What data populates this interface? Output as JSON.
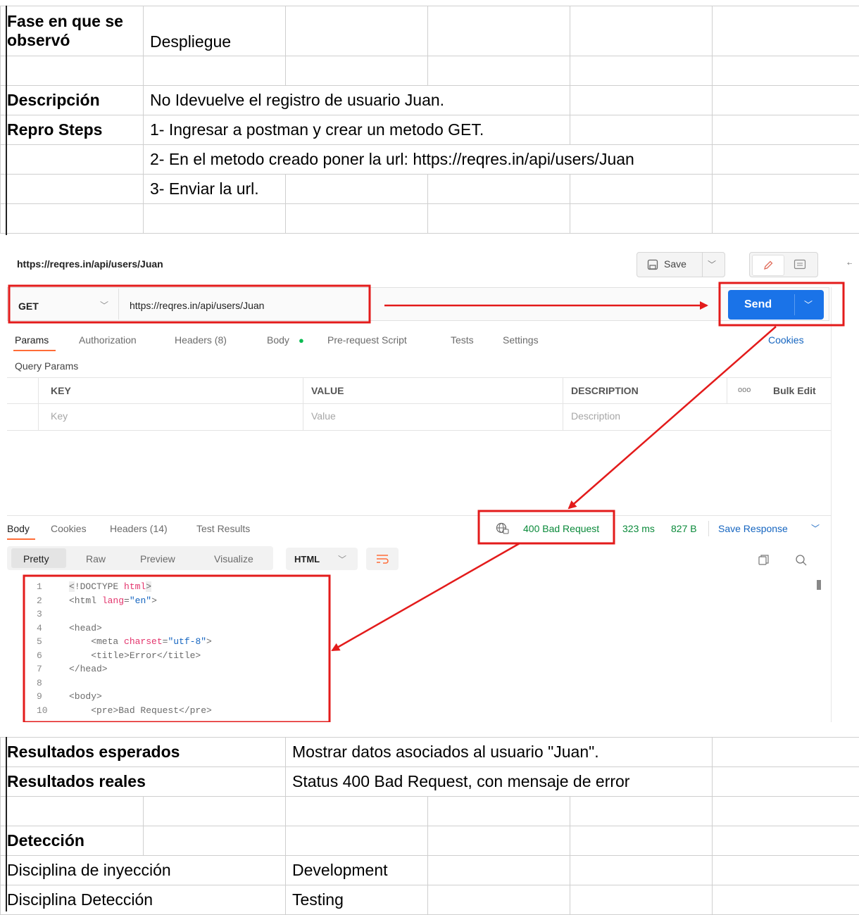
{
  "sheet_top": {
    "rows": [
      {
        "label": "Fase en que se observó",
        "value": "Despliegue"
      },
      {
        "label": "",
        "value": ""
      },
      {
        "label": "Descripción",
        "value": "No Idevuelve el registro de usuario Juan."
      },
      {
        "label": "Repro Steps",
        "value": "1- Ingresar a postman y crear un metodo GET."
      },
      {
        "label": "",
        "value": "2- En el metodo creado poner la url: https://reqres.in/api/users/Juan"
      },
      {
        "label": "",
        "value": "3- Enviar la url."
      },
      {
        "label": "",
        "value": ""
      }
    ],
    "fase_line1": "Fase en que se",
    "fase_line2": "observó"
  },
  "postman": {
    "request_title": "https://reqres.in/api/users/Juan",
    "save_label": "Save",
    "method": "GET",
    "url": "https://reqres.in/api/users/Juan",
    "send_label": "Send",
    "tabs": [
      "Params",
      "Authorization",
      "Headers (8)",
      "Body",
      "Pre-request Script",
      "Tests",
      "Settings"
    ],
    "cookies_link": "Cookies",
    "query_params_label": "Query Params",
    "table_headers": {
      "key": "KEY",
      "value": "VALUE",
      "description": "DESCRIPTION",
      "bulk_edit": "Bulk Edit",
      "more": "ooo"
    },
    "placeholders": {
      "key": "Key",
      "value": "Value",
      "description": "Description"
    },
    "response_tabs": [
      "Body",
      "Cookies",
      "Headers (14)",
      "Test Results"
    ],
    "status": "400 Bad Request",
    "time": "323 ms",
    "size": "827 B",
    "save_response": "Save Response",
    "view_tabs": [
      "Pretty",
      "Raw",
      "Preview",
      "Visualize"
    ],
    "format": "HTML",
    "code_line_numbers": [
      "1",
      "2",
      "3",
      "4",
      "5",
      "6",
      "7",
      "8",
      "9",
      "10"
    ],
    "colors": {
      "send": "#1a73e8",
      "status_green": "#0a8a3a",
      "annotation_red": "#e31b1b",
      "link_blue": "#1565c0"
    }
  },
  "sheet_bottom": {
    "rows": [
      {
        "label": "Resultados esperados",
        "value": "Mostrar datos asociados al usuario \"Juan\"."
      },
      {
        "label": "Resultados reales",
        "value": "Status 400 Bad Request, con mensaje de error"
      },
      {
        "label": "",
        "value": ""
      },
      {
        "label": "Detección",
        "value": ""
      },
      {
        "label": "Disciplina de inyección",
        "value": "Development"
      },
      {
        "label": "Disciplina Detección",
        "value": "Testing"
      }
    ]
  }
}
